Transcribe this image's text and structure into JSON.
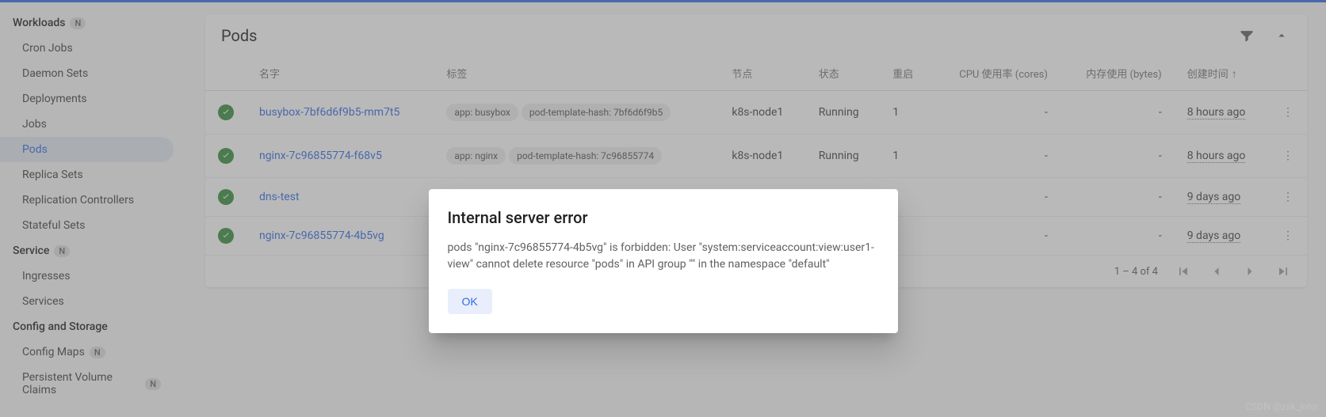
{
  "sidebar": {
    "sections": [
      {
        "label": "Workloads",
        "badge": "N",
        "items": [
          "Cron Jobs",
          "Daemon Sets",
          "Deployments",
          "Jobs",
          "Pods",
          "Replica Sets",
          "Replication Controllers",
          "Stateful Sets"
        ]
      },
      {
        "label": "Service",
        "badge": "N",
        "items": [
          "Ingresses",
          "Services"
        ]
      },
      {
        "label": "Config and Storage",
        "items": [
          "Config Maps",
          "Persistent Volume Claims"
        ],
        "badges": [
          "N",
          "N"
        ]
      }
    ]
  },
  "main": {
    "title": "Pods",
    "columns": [
      "名字",
      "标签",
      "节点",
      "状态",
      "重启",
      "CPU 使用率 (cores)",
      "内存使用 (bytes)",
      "创建时间"
    ],
    "rows": [
      {
        "name": "busybox-7bf6d6f9b5-mm7t5",
        "labels": [
          "app: busybox",
          "pod-template-hash: 7bf6d6f9b5"
        ],
        "node": "k8s-node1",
        "status": "Running",
        "restarts": "1",
        "cpu": "-",
        "mem": "-",
        "created": "8 hours ago"
      },
      {
        "name": "nginx-7c96855774-f68v5",
        "labels": [
          "app: nginx",
          "pod-template-hash: 7c96855774"
        ],
        "node": "k8s-node1",
        "status": "Running",
        "restarts": "1",
        "cpu": "-",
        "mem": "-",
        "created": "8 hours ago"
      },
      {
        "name": "dns-test",
        "labels": [],
        "node": "",
        "status": "",
        "restarts": "",
        "cpu": "-",
        "mem": "-",
        "created": "9 days ago"
      },
      {
        "name": "nginx-7c96855774-4b5vg",
        "labels": [],
        "node": "",
        "status": "",
        "restarts": "",
        "cpu": "-",
        "mem": "-",
        "created": "9 days ago"
      }
    ],
    "pagination": "1 – 4 of 4"
  },
  "dialog": {
    "title": "Internal server error",
    "message": "pods \"nginx-7c96855774-4b5vg\" is forbidden: User \"system:serviceaccount:view:user1-view\" cannot delete resource \"pods\" in API group \"\" in the namespace \"default\"",
    "ok": "OK"
  },
  "watermark": "CSDN @zsk_john"
}
